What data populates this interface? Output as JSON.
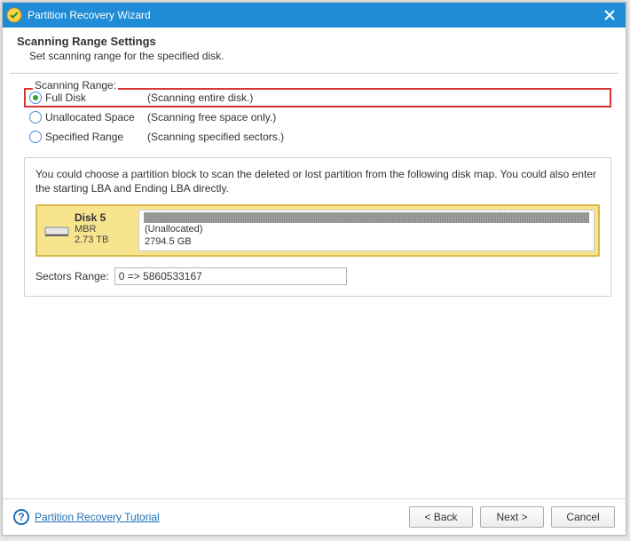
{
  "window": {
    "title": "Partition Recovery Wizard"
  },
  "header": {
    "title": "Scanning Range Settings",
    "subtitle": "Set scanning range for the specified disk."
  },
  "legend": "Scanning Range:",
  "options": {
    "full_disk": {
      "label": "Full Disk",
      "hint": "(Scanning entire disk.)"
    },
    "unallocated": {
      "label": "Unallocated Space",
      "hint": "(Scanning free space only.)"
    },
    "specified": {
      "label": "Specified Range",
      "hint": "(Scanning specified sectors.)"
    }
  },
  "map": {
    "description": "You could choose a partition block to scan the deleted or lost partition from the following disk map. You could also enter the starting LBA and Ending LBA directly.",
    "disk": {
      "name": "Disk 5",
      "scheme": "MBR",
      "size": "2.73 TB",
      "part_label": "(Unallocated)",
      "part_size": "2794.5 GB"
    }
  },
  "sectors": {
    "label": "Sectors Range:",
    "value": "0 => 5860533167"
  },
  "footer": {
    "tutorial": "Partition Recovery Tutorial",
    "back": "< Back",
    "next": "Next >",
    "cancel": "Cancel"
  }
}
